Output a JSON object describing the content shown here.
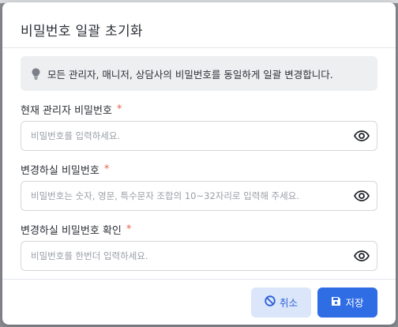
{
  "modal": {
    "title": "비밀번호 일괄 초기화",
    "notice": "모든 관리자, 매니저, 상담사의 비밀번호를 동일하게 일괄 변경합니다."
  },
  "fields": [
    {
      "label": "현재 관리자 비밀번호",
      "required_mark": "*",
      "placeholder": "비밀번호를 입력하세요.",
      "value": ""
    },
    {
      "label": "변경하실 비밀번호",
      "required_mark": "*",
      "placeholder": "비밀번호는 숫자, 영문, 특수문자 조합의 10~32자리로 입력해 주세요.",
      "value": ""
    },
    {
      "label": "변경하실 비밀번호 확인",
      "required_mark": "*",
      "placeholder": "비밀번호를 한번더 입력하세요.",
      "value": ""
    }
  ],
  "footer": {
    "cancel_label": "취소",
    "save_label": "저장"
  },
  "colors": {
    "primary": "#2f6de5",
    "cancel_bg": "#dbe6fb",
    "required": "#e8644a"
  },
  "icons": [
    "lightbulb-icon",
    "eye-icon",
    "ban-icon",
    "save-icon"
  ]
}
